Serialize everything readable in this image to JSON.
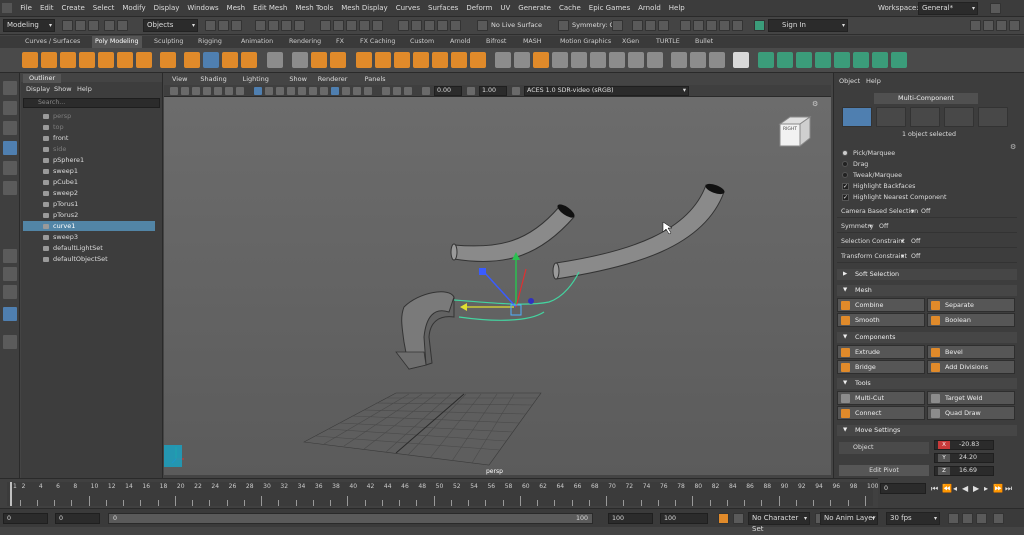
{
  "menubar": {
    "items": [
      "File",
      "Edit",
      "Create",
      "Select",
      "Modify",
      "Display",
      "Windows",
      "Mesh",
      "Edit Mesh",
      "Mesh Tools",
      "Mesh Display",
      "Curves",
      "Surfaces",
      "Deform",
      "UV",
      "Generate",
      "Cache",
      "Epic Games",
      "Arnold",
      "Help"
    ],
    "workspace_label": "Workspace:",
    "workspace_value": "General*"
  },
  "statusline": {
    "menuset": "Modeling",
    "objects_label": "Objects",
    "live_surface": "No Live Surface",
    "symmetry": "Symmetry: Off",
    "sign_in": "Sign In"
  },
  "shelf_tabs": [
    "Curves / Surfaces",
    "Poly Modeling",
    "Sculpting",
    "Rigging",
    "Animation",
    "Rendering",
    "FX",
    "FX Caching",
    "Custom",
    "Arnold",
    "Bifrost",
    "MASH",
    "Motion Graphics",
    "XGen",
    "TURTLE",
    "Bullet"
  ],
  "shelf_active_tab": "Poly Modeling",
  "outliner": {
    "title": "Outliner",
    "menu": [
      "Display",
      "Show",
      "Help"
    ],
    "search_placeholder": "Search...",
    "items": [
      {
        "label": "persp",
        "state": "dim"
      },
      {
        "label": "top",
        "state": "dim"
      },
      {
        "label": "front",
        "state": "normal"
      },
      {
        "label": "side",
        "state": "dim"
      },
      {
        "label": "pSphere1",
        "state": "normal"
      },
      {
        "label": "sweep1",
        "state": "normal"
      },
      {
        "label": "pCube1",
        "state": "normal"
      },
      {
        "label": "sweep2",
        "state": "normal"
      },
      {
        "label": "pTorus1",
        "state": "normal"
      },
      {
        "label": "pTorus2",
        "state": "normal"
      },
      {
        "label": "curve1",
        "state": "selected"
      },
      {
        "label": "sweep3",
        "state": "normal"
      },
      {
        "label": "defaultLightSet",
        "state": "normal"
      },
      {
        "label": "defaultObjectSet",
        "state": "normal"
      }
    ]
  },
  "viewport": {
    "menu": [
      "View",
      "Shading",
      "Lighting",
      "Show",
      "Renderer",
      "Panels"
    ],
    "field_a": "0.00",
    "field_b": "1.00",
    "colorspace": "ACES 1.0 SDR-video (sRGB)",
    "camera_label": "persp",
    "viewcube_label": "RIGHT"
  },
  "modeling_toolkit": {
    "menu": [
      "Object",
      "Help"
    ],
    "mode_title": "Multi-Component",
    "selection_count": "1 object selected",
    "pick_marquee": "Pick/Marquee",
    "drag": "Drag",
    "tweak_marquee": "Tweak/Marquee",
    "highlight_backfaces": "Highlight Backfaces",
    "highlight_nearest": "Highlight Nearest Component",
    "camera_based_selection": "Camera Based Selection",
    "camera_based_value": "Off",
    "symmetry_label": "Symmetry",
    "symmetry_value": "Off",
    "selection_constraint": "Selection Constraint",
    "selection_constraint_value": "Off",
    "transform_constraint": "Transform Constraint",
    "transform_constraint_value": "Off",
    "soft_selection": "Soft Selection",
    "sections": {
      "mesh": {
        "title": "Mesh",
        "buttons": [
          "Combine",
          "Separate",
          "Smooth",
          "Boolean"
        ]
      },
      "components": {
        "title": "Components",
        "buttons": [
          "Extrude",
          "Bevel",
          "Bridge",
          "Add Divisions"
        ]
      },
      "tools": {
        "title": "Tools",
        "buttons": [
          "Multi-Cut",
          "Target Weld",
          "Connect",
          "Quad Draw"
        ]
      },
      "move_settings": {
        "title": "Move Settings",
        "object_label": "Object",
        "edit_pivot": "Edit Pivot",
        "x": "-20.83",
        "y": "24.20",
        "z": "16.69"
      }
    }
  },
  "timeslider": {
    "ticks": [
      1,
      2,
      4,
      6,
      8,
      10,
      12,
      14,
      16,
      18,
      20,
      22,
      24,
      26,
      28,
      30,
      32,
      34,
      36,
      38,
      40,
      42,
      44,
      46,
      48,
      50,
      52,
      54,
      56,
      58,
      60,
      62,
      64,
      66,
      68,
      70,
      72,
      74,
      76,
      78,
      80,
      82,
      84,
      86,
      88,
      90,
      92,
      94,
      96,
      98,
      100
    ],
    "current_frame": "0"
  },
  "rangeslider": {
    "start": "0",
    "anim_start": "0",
    "range_start": "0",
    "range_end": "100",
    "anim_end": "100",
    "end": "100",
    "character_set": "No Character Set",
    "anim_layer": "No Anim Layer",
    "fps": "30 fps"
  },
  "colors": {
    "selection_blue": "#5285a6",
    "tool_orange": "#e08a2a",
    "shelf_green": "#3b9c7a",
    "viewport_gray": "#636363"
  }
}
